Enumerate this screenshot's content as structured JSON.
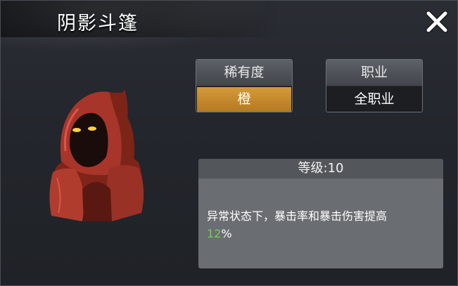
{
  "title": "阴影斗篷",
  "rarity": {
    "label": "稀有度",
    "value": "橙",
    "color": "#c98a2c"
  },
  "class": {
    "label": "职业",
    "value": "全职业"
  },
  "level": {
    "text": "等级:10"
  },
  "description": {
    "text": "异常状态下，暴击率和暴击伤害提高",
    "highlight_value": "12",
    "unit": "%"
  },
  "icons": {
    "close": "close-x-icon",
    "item": "red-hooded-cloak-item"
  }
}
